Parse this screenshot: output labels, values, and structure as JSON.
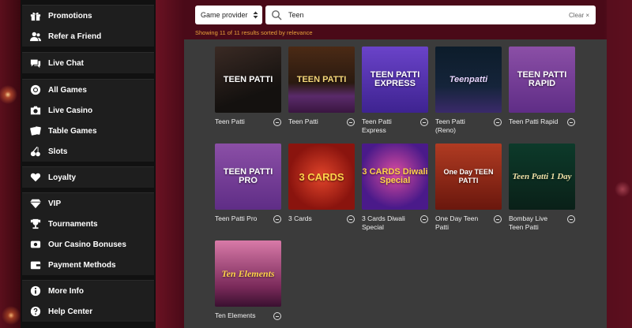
{
  "sidebar": {
    "items": [
      {
        "label": "Promotions",
        "icon": "gift-icon"
      },
      {
        "label": "Refer a Friend",
        "icon": "users-icon"
      },
      {
        "label": "Live Chat",
        "icon": "chat-icon"
      },
      {
        "label": "All Games",
        "icon": "chip-icon"
      },
      {
        "label": "Live Casino",
        "icon": "camera-icon"
      },
      {
        "label": "Table Games",
        "icon": "cards-icon"
      },
      {
        "label": "Slots",
        "icon": "cherry-icon"
      },
      {
        "label": "Loyalty",
        "icon": "heart-icon"
      },
      {
        "label": "VIP",
        "icon": "diamond-icon"
      },
      {
        "label": "Tournaments",
        "icon": "trophy-icon"
      },
      {
        "label": "Our Casino Bonuses",
        "icon": "bonus-icon"
      },
      {
        "label": "Payment Methods",
        "icon": "wallet-icon"
      },
      {
        "label": "More Info",
        "icon": "info-icon"
      },
      {
        "label": "Help Center",
        "icon": "help-icon"
      }
    ]
  },
  "search": {
    "provider_label": "Game provider",
    "query": "Teen",
    "clear_label": "Clear ×",
    "results_text": "Showing 11 of 11 results sorted by relevance"
  },
  "games": [
    {
      "name": "Teen Patti",
      "thumb_title": "TEEN PATTI"
    },
    {
      "name": "Teen Patti",
      "thumb_title": "TEEN PATTI"
    },
    {
      "name": "Teen Patti Express",
      "thumb_title": "TEEN PATTI EXPRESS"
    },
    {
      "name": "Teen Patti (Reno)",
      "thumb_title": "Teenpatti"
    },
    {
      "name": "Teen Patti Rapid",
      "thumb_title": "TEEN PATTI RAPID"
    },
    {
      "name": "Teen Patti Pro",
      "thumb_title": "TEEN PATTI PRO"
    },
    {
      "name": "3 Cards",
      "thumb_title": "3 CARDS"
    },
    {
      "name": "3 Cards Diwali Special",
      "thumb_title": "3 CARDS Diwali Special"
    },
    {
      "name": "One Day Teen Patti",
      "thumb_title": "One Day TEEN PATTI"
    },
    {
      "name": "Bombay Live Teen Patti",
      "thumb_title": "Teen Patti 1 Day"
    },
    {
      "name": "Ten Elements",
      "thumb_title": "Ten Elements"
    }
  ],
  "colors": {
    "accent": "#e8a23a",
    "panel": "#3b3b3b",
    "sidebar": "#1e1e1e"
  }
}
